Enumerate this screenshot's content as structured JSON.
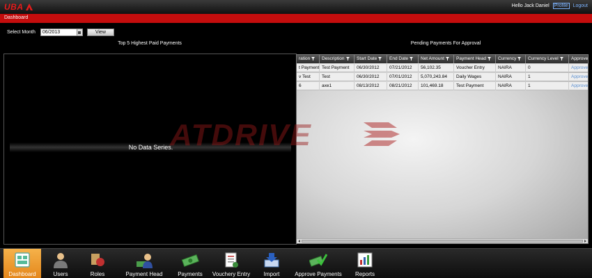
{
  "header": {
    "logo": "UBA",
    "greeting": "Hello Jack Daniel",
    "profile": "Profile",
    "logout": "Logout"
  },
  "breadcrumb": "Dashboard",
  "month_selector": {
    "label": "Select Month",
    "value": "06/2013",
    "view_button": "View"
  },
  "chart_section": {
    "title": "Top 5 Highest Paid Payments",
    "empty_text": "No Data Series."
  },
  "watermark": "ATDRIVE",
  "table_section": {
    "title": "Pending Payments For Approval",
    "columns": [
      "ration",
      "Description",
      "Start Date",
      "End Date",
      "Net Amount",
      "Payment Head",
      "Currency",
      "Currency Level",
      "Approve"
    ],
    "rows": [
      [
        "t Payment",
        "Test Payment",
        "06/30/2012",
        "07/21/2012",
        "56,102.35",
        "Voucher Entry",
        "NAIRA",
        "0",
        "Approve"
      ],
      [
        "v Test",
        "Test",
        "06/30/2012",
        "07/01/2012",
        "5,070,243.84",
        "Daily Wages",
        "NAIRA",
        "1",
        "Approve"
      ],
      [
        "6",
        "axe1",
        "08/13/2012",
        "08/21/2012",
        "101,469.18",
        "Test Payment",
        "NAIRA",
        "1",
        "Approve"
      ]
    ]
  },
  "nav": {
    "items": [
      {
        "label": "Dashboard",
        "icon": "dashboard-icon",
        "active": true
      },
      {
        "label": "Users",
        "icon": "user-icon",
        "active": false
      },
      {
        "label": "Roles",
        "icon": "roles-icon",
        "active": false
      },
      {
        "label": "Payment Head",
        "icon": "payment-head-icon",
        "active": false
      },
      {
        "label": "Payments",
        "icon": "money-icon",
        "active": false
      },
      {
        "label": "Vouchery Entry",
        "icon": "voucher-icon",
        "active": false
      },
      {
        "label": "Import",
        "icon": "import-icon",
        "active": false
      },
      {
        "label": "Approve Payments",
        "icon": "approve-icon",
        "active": false
      },
      {
        "label": "Reports",
        "icon": "reports-icon",
        "active": false
      }
    ]
  },
  "colors": {
    "brand_red": "#c40d0d",
    "active_nav": "#e4871b",
    "link": "#7db4ff"
  }
}
